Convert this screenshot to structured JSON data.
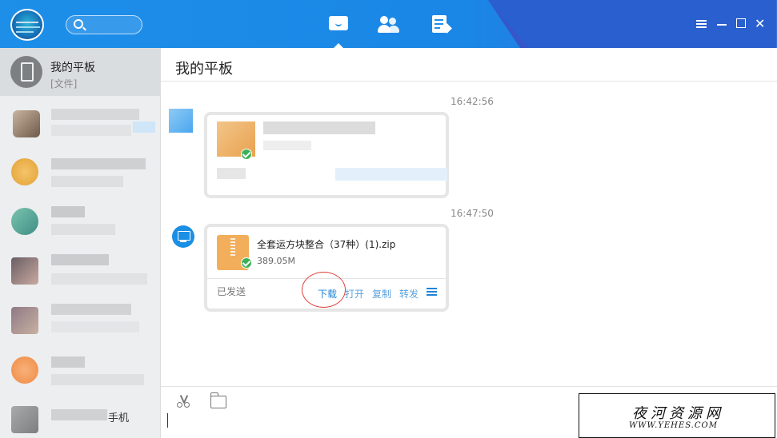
{
  "header": {
    "icons": [
      "app-avatar",
      "search-icon",
      "chat-icon",
      "contacts-icon",
      "notes-icon",
      "menu-icon",
      "minimize-icon",
      "maximize-icon",
      "close-icon"
    ]
  },
  "sidebar": {
    "active_item": {
      "name": "我的平板",
      "sub": "[文件]"
    },
    "partial_text": "手机"
  },
  "chat": {
    "title": "我的平板",
    "timestamps": [
      "16:42:56",
      "16:47:50"
    ],
    "file_message": {
      "file_name": "全套运方块整合（37种）(1).zip",
      "file_size": "389.05M",
      "status": "已发送",
      "actions": {
        "download": "下载",
        "open": "打开",
        "copy": "复制",
        "forward": "转发"
      }
    }
  },
  "toolbar": {
    "icons": [
      "scissors-icon",
      "folder-icon"
    ]
  },
  "watermark": {
    "title": "夜河资源网",
    "url": "WWW.YEHES.COM"
  },
  "colors": {
    "brand_blue": "#1d8fe8",
    "sidebar_bg": "#eceef0",
    "link_blue": "#1f84d8",
    "highlight_red": "#e0403a"
  }
}
